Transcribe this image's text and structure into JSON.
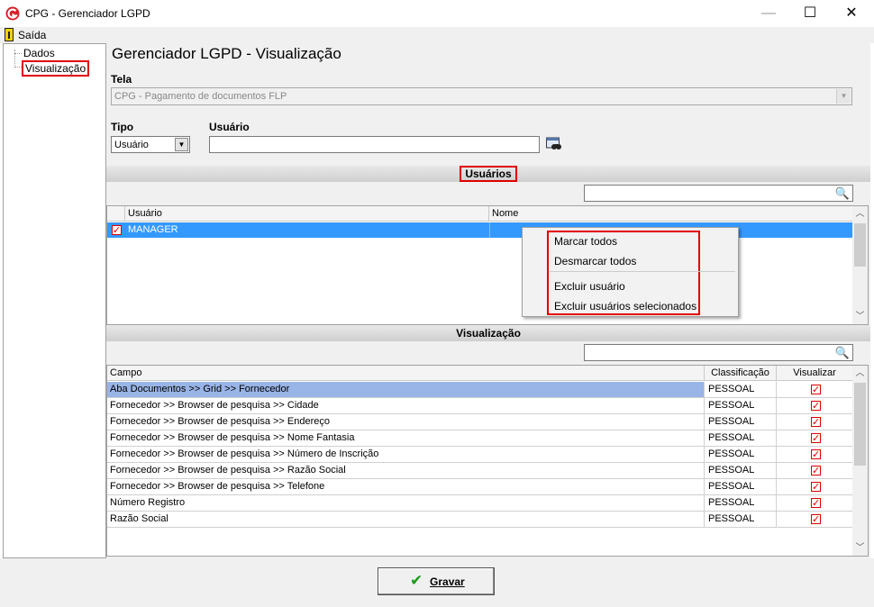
{
  "window": {
    "title": "CPG - Gerenciador LGPD",
    "minimize_icon": "minimize-icon",
    "maximize_icon": "maximize-icon",
    "close_icon": "close-icon",
    "min_glyph": "—",
    "max_glyph": "☐",
    "close_glyph": "✕"
  },
  "menubar": {
    "exit_label": "Saída"
  },
  "tree": {
    "items": [
      {
        "label": "Dados"
      },
      {
        "label": "Visualização",
        "highlighted": true
      }
    ]
  },
  "main": {
    "title": "Gerenciador LGPD - Visualização",
    "tela_label": "Tela",
    "tela_value": "CPG - Pagamento de documentos FLP",
    "tipo_label": "Tipo",
    "tipo_value": "Usuário",
    "usuario_label": "Usuário",
    "usuario_value": ""
  },
  "usuarios": {
    "section_title": "Usuários",
    "search_value": "",
    "columns": [
      "Usuário",
      "Nome"
    ],
    "rows": [
      {
        "checked": true,
        "usuario": "MANAGER",
        "nome": ""
      }
    ]
  },
  "context_menu": {
    "items": [
      "Marcar todos",
      "Desmarcar todos",
      "Excluir usuário",
      "Excluir usuários selecionados"
    ]
  },
  "visualizacao": {
    "section_title": "Visualização",
    "search_value": "",
    "columns": [
      "Campo",
      "Classificação",
      "Visualizar"
    ],
    "rows": [
      {
        "campo": "Aba Documentos >> Grid >> Fornecedor",
        "classificacao": "PESSOAL",
        "visualizar": true,
        "selected": true
      },
      {
        "campo": "Fornecedor >> Browser de pesquisa >> Cidade",
        "classificacao": "PESSOAL",
        "visualizar": true
      },
      {
        "campo": "Fornecedor >> Browser de pesquisa >> Endereço",
        "classificacao": "PESSOAL",
        "visualizar": true
      },
      {
        "campo": "Fornecedor >> Browser de pesquisa >> Nome Fantasia",
        "classificacao": "PESSOAL",
        "visualizar": true
      },
      {
        "campo": "Fornecedor >> Browser de pesquisa >> Número de Inscrição",
        "classificacao": "PESSOAL",
        "visualizar": true
      },
      {
        "campo": "Fornecedor >> Browser de pesquisa >> Razão Social",
        "classificacao": "PESSOAL",
        "visualizar": true
      },
      {
        "campo": "Fornecedor >> Browser de pesquisa >> Telefone",
        "classificacao": "PESSOAL",
        "visualizar": true
      },
      {
        "campo": "Número Registro",
        "classificacao": "PESSOAL",
        "visualizar": true
      },
      {
        "campo": "Razão Social",
        "classificacao": "PESSOAL",
        "visualizar": true
      }
    ]
  },
  "footer": {
    "save_label_underlined": "G",
    "save_label_rest": "ravar",
    "save_icon": "checkmark-icon"
  },
  "colors": {
    "selection": "#3399ff",
    "row_selected": "#99b4e6",
    "highlight_border": "#e00000",
    "check_red": "#dd0000",
    "save_check": "#1a9a1a"
  }
}
